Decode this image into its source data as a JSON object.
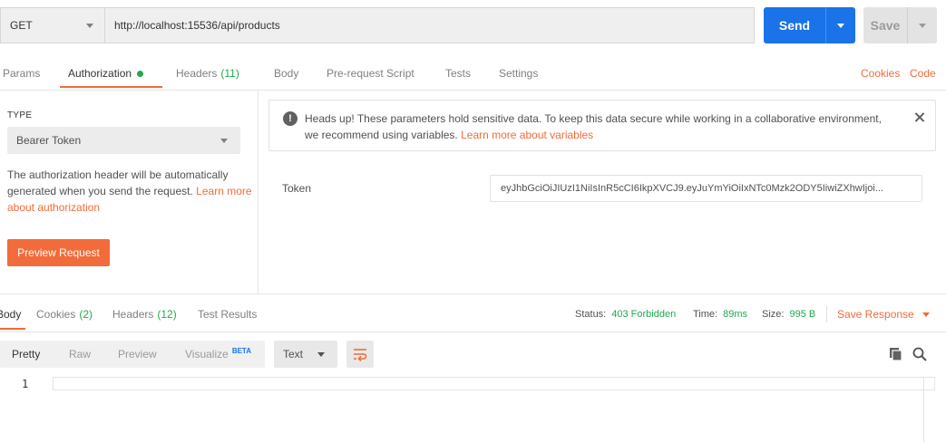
{
  "request": {
    "method": "GET",
    "url": "http://localhost:15536/api/products",
    "send_label": "Send",
    "save_label": "Save"
  },
  "request_tabs": [
    {
      "label": "Params"
    },
    {
      "label": "Authorization"
    },
    {
      "label": "Headers",
      "count": "(11)"
    },
    {
      "label": "Body"
    },
    {
      "label": "Pre-request Script"
    },
    {
      "label": "Tests"
    },
    {
      "label": "Settings"
    }
  ],
  "links": {
    "cookies": "Cookies",
    "code": "Code"
  },
  "auth": {
    "type_label": "TYPE",
    "type_value": "Bearer Token",
    "description": "The authorization header will be automatically generated when you send the request.",
    "learn_more": "Learn more about authorization",
    "preview_button": "Preview Request",
    "alert_text": "Heads up! These parameters hold sensitive data. To keep this data secure while working in a collaborative environment, we recommend using variables.",
    "alert_link": "Learn more about variables",
    "token_label": "Token",
    "token_value": "eyJhbGciOiJIUzI1NiIsInR5cCI6IkpXVCJ9.eyJuYmYiOiIxNTc0Mzk2ODY5IiwiZXhwIjoi..."
  },
  "response_tabs": [
    {
      "label": "Body"
    },
    {
      "label": "Cookies",
      "count": "(2)"
    },
    {
      "label": "Headers",
      "count": "(12)"
    },
    {
      "label": "Test Results"
    }
  ],
  "response_meta": {
    "status_label": "Status:",
    "status_value": "403 Forbidden",
    "time_label": "Time:",
    "time_value": "89ms",
    "size_label": "Size:",
    "size_value": "995 B",
    "save_response": "Save Response"
  },
  "view_tabs": [
    {
      "label": "Pretty"
    },
    {
      "label": "Raw"
    },
    {
      "label": "Preview"
    },
    {
      "label": "Visualize",
      "badge": "BETA"
    }
  ],
  "format": "Text",
  "editor": {
    "line_number": "1"
  },
  "colors": {
    "accent": "#f26b3a",
    "primary": "#1a73e8",
    "success": "#20a94e"
  },
  "icons": {
    "info": "info-icon",
    "close": "close-icon",
    "wrap": "wrap-lines-icon",
    "copy": "copy-icon",
    "search": "search-icon"
  }
}
